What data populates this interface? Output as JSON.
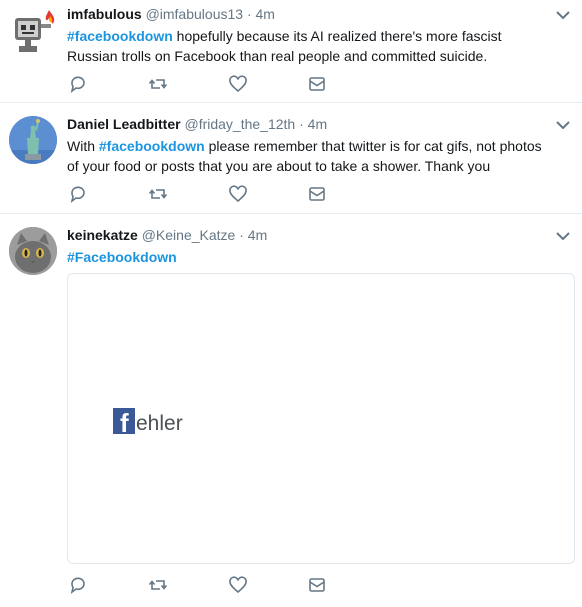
{
  "tweets": [
    {
      "name": "imfabulous",
      "handle": "@imfabulous13",
      "separator": "·",
      "time": "4m",
      "hashtag": "#facebookdown",
      "text_before": "",
      "text_after": " hopefully because its AI realized there's more fascist Russian trolls on Facebook than real people and committed suicide."
    },
    {
      "name": "Daniel Leadbitter",
      "handle": "@friday_the_12th",
      "separator": "·",
      "time": "4m",
      "hashtag": "#facebookdown",
      "text_before": "With ",
      "text_after": " please remember that twitter is for cat gifs, not photos of your food or posts that you are about to take a shower. Thank you"
    },
    {
      "name": "keinekatze",
      "handle": "@Keine_Katze",
      "separator": "·",
      "time": "4m",
      "hashtag": "#Facebookdown",
      "text_before": "",
      "text_after": "",
      "media": {
        "logo_letter": "f",
        "word": "ehler"
      }
    }
  ],
  "icons": [
    "reply-icon",
    "retweet-icon",
    "like-icon",
    "message-icon",
    "chevron-down-icon"
  ],
  "colors": {
    "hashtag": "#1b95e0",
    "meta": "#657786",
    "icon": "#657786",
    "divider": "#e6ecf0",
    "facebook_blue": "#3b5998"
  }
}
